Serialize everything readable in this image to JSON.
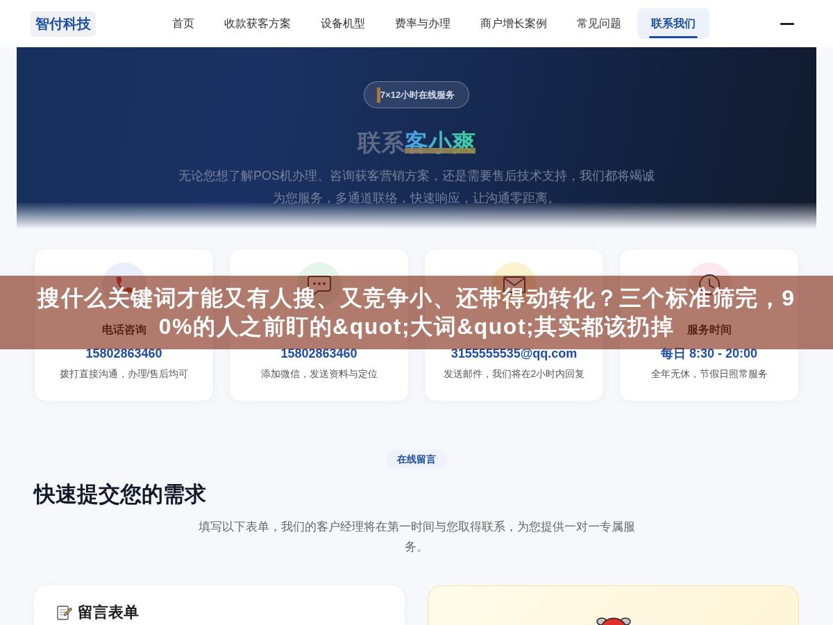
{
  "header": {
    "logo": "智付科技",
    "nav": [
      {
        "label": "首页",
        "selected": false
      },
      {
        "label": "收款获客方案",
        "selected": false
      },
      {
        "label": "设备机型",
        "selected": false
      },
      {
        "label": "费率与办理",
        "selected": false
      },
      {
        "label": "商户增长案例",
        "selected": false
      },
      {
        "label": "常见问题",
        "selected": false
      },
      {
        "label": "联系我们",
        "selected": true
      }
    ]
  },
  "hero": {
    "badge": "7×12小时在线服务",
    "title": "联系",
    "title_highlight": "客小爽",
    "description": "无论您想了解POS机办理、咨询获客营销方案，还是需要售后技术支持，我们都将竭诚为您服务，多通道联络，快速响应，让沟通零距离。"
  },
  "contact_cards": [
    {
      "kind": "phone",
      "color": "#e8eefb",
      "title": "电话咨询",
      "value": "15802863460",
      "note": "拨打直接沟通，办理/售后均可"
    },
    {
      "kind": "chat",
      "color": "#e4f6ea",
      "value": "15802863460",
      "note": "添加微信，发送资料与定位"
    },
    {
      "kind": "mail",
      "color": "#fbf1cc",
      "value": "3155555535@qq.com",
      "note": "发送邮件，我们将在2小时内回复"
    },
    {
      "kind": "clock",
      "color": "#fbe8f0",
      "title": "服务时间",
      "value": "每日 8:30 - 20:00",
      "note": "全年无休，节假日照常服务"
    }
  ],
  "message_section": {
    "tag": "在线留言",
    "heading": "快速提交您的需求",
    "description": "填写以下表单，我们的客户经理将在第一时间与您取得联系，为您提供一对一专属服务。"
  },
  "form_card": {
    "title": "留言表单"
  },
  "overlay_banner": "搜什么关键词才能又有人搜、又竞争小、还带得动转化？三个标准筛完，90%的人之前盯的&quot;大词&quot;其实都该扔掉"
}
